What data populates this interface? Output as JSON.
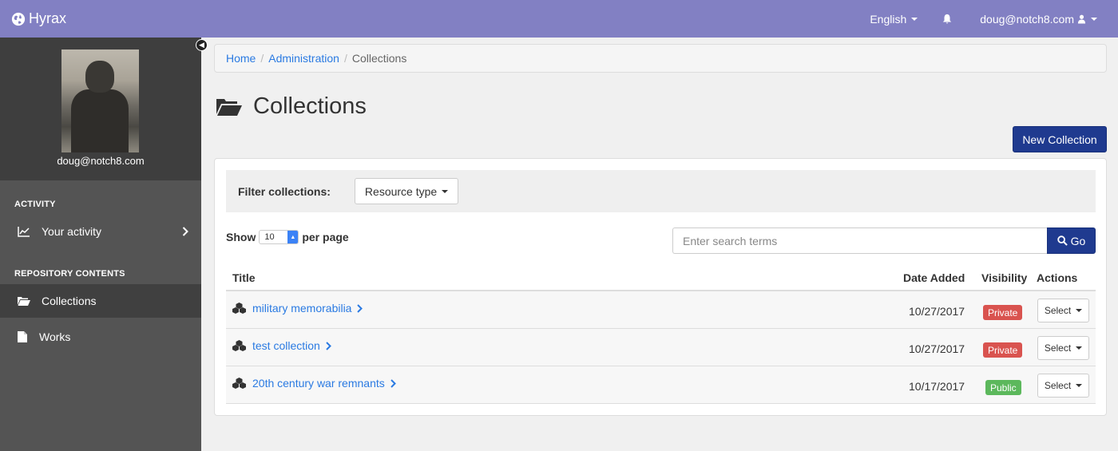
{
  "app": {
    "brand": "Hyrax"
  },
  "topnav": {
    "language": "English",
    "user": "doug@notch8.com"
  },
  "sidebar": {
    "profile_name": "doug@notch8.com",
    "activity_heading": "ACTIVITY",
    "activity_item": "Your activity",
    "repo_heading": "REPOSITORY CONTENTS",
    "collections_item": "Collections",
    "works_item": "Works"
  },
  "breadcrumb": {
    "home": "Home",
    "admin": "Administration",
    "current": "Collections",
    "sep": "/"
  },
  "page": {
    "title": "Collections",
    "new_button": "New Collection"
  },
  "filter": {
    "label": "Filter collections:",
    "resource_type": "Resource type"
  },
  "pagination": {
    "show": "Show",
    "per_page_value": "10",
    "per_page": "per page"
  },
  "search": {
    "placeholder": "Enter search terms",
    "go": "Go"
  },
  "table": {
    "headers": {
      "title": "Title",
      "date": "Date Added",
      "visibility": "Visibility",
      "actions": "Actions"
    },
    "rows": [
      {
        "title": "military memorabilia",
        "date": "10/27/2017",
        "visibility": "Private",
        "action": "Select"
      },
      {
        "title": "test collection",
        "date": "10/27/2017",
        "visibility": "Private",
        "action": "Select"
      },
      {
        "title": "20th century war remnants",
        "date": "10/17/2017",
        "visibility": "Public",
        "action": "Select"
      }
    ]
  },
  "colors": {
    "topbar": "#8280c3",
    "primary": "#1f3a8f",
    "link": "#2a7ae2",
    "private": "#d9534f",
    "public": "#5cb85c"
  }
}
